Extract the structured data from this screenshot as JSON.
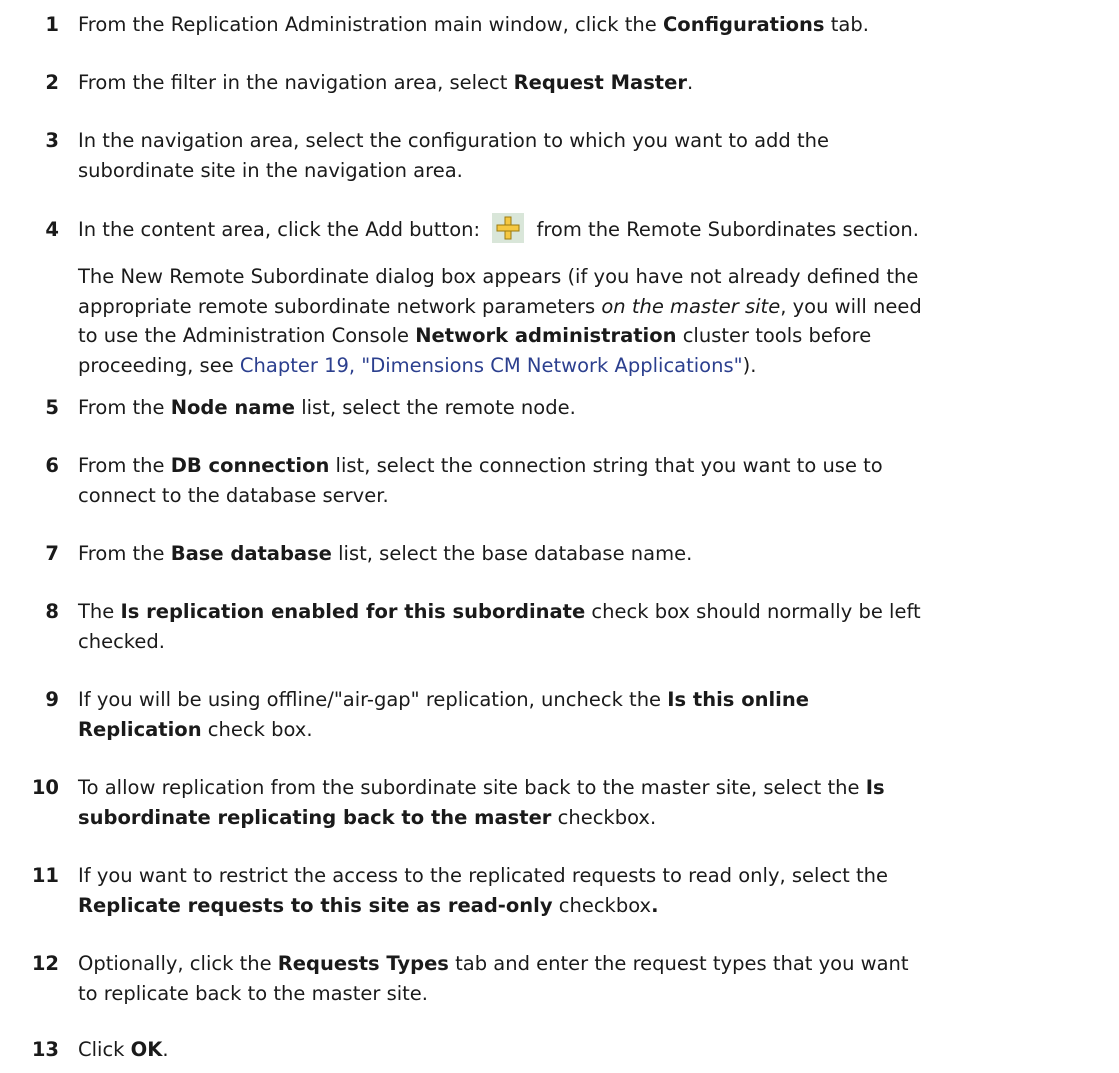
{
  "steps": [
    {
      "n": "1",
      "a": "From the Replication Administration main window, click the ",
      "b": "Configurations",
      "c": " tab."
    },
    {
      "n": "2",
      "a": "From the filter in the navigation area, select ",
      "b": "Request Master",
      "c": "."
    },
    {
      "n": "3",
      "l1": "In the navigation area, select the configuration to which you want to add the",
      "l2": "subordinate site in the navigation area."
    },
    {
      "n": "4",
      "a": "In the content area, click the Add button: ",
      "c": " from the Remote Subordinates section.",
      "para": {
        "p1": "The New Remote Subordinate dialog box appears (if you have not already defined the",
        "p2a": "appropriate remote subordinate network parameters ",
        "p2i": "on the master site",
        "p2b": ", you will need",
        "p3a": "to use the Administration Console ",
        "p3b": "Network administration",
        "p3c": " cluster tools before",
        "p4a": "proceeding, see ",
        "p4link": "Chapter 19, \"Dimensions CM Network Applications\"",
        "p4b": ")."
      }
    },
    {
      "n": "5",
      "a": "From the ",
      "b": "Node name",
      "c": " list, select the remote node."
    },
    {
      "n": "6",
      "a": "From the ",
      "b": "DB connection",
      "c": " list, select the connection string that you want to use to",
      "l2": "connect to the database server."
    },
    {
      "n": "7",
      "a": "From the ",
      "b": "Base database",
      "c": " list, select the base database name."
    },
    {
      "n": "8",
      "a": "The ",
      "b": "Is replication enabled for this subordinate",
      "c": " check box should normally be left",
      "l2": "checked."
    },
    {
      "n": "9",
      "a": "If you will be using offline/\"air-gap\" replication, uncheck the ",
      "b": "Is this online",
      "l2b": "Replication",
      "l2c": " check box."
    },
    {
      "n": "10",
      "a": "To allow replication from the subordinate site back to the master site, select the ",
      "b": "Is",
      "l2b": "subordinate replicating back to the master",
      "l2c": " checkbox."
    },
    {
      "n": "11",
      "a": "If you want to restrict the access to the replicated requests to read only, select the",
      "l2b": "Replicate requests to this site as read-only",
      "l2c": " checkbox",
      "l2d": "."
    },
    {
      "n": "12",
      "a": "Optionally, click the ",
      "b": "Requests Types",
      "c": " tab and enter the request types that you want",
      "l2": "to replicate back to the master site."
    },
    {
      "n": "13",
      "a": "Click ",
      "b": "OK",
      "c": "."
    }
  ],
  "icons": {
    "add": "add-plus-icon"
  },
  "colors": {
    "link": "#2b3f8e",
    "icon_fill": "#f5c842",
    "icon_bg": "#d9e6d9"
  }
}
